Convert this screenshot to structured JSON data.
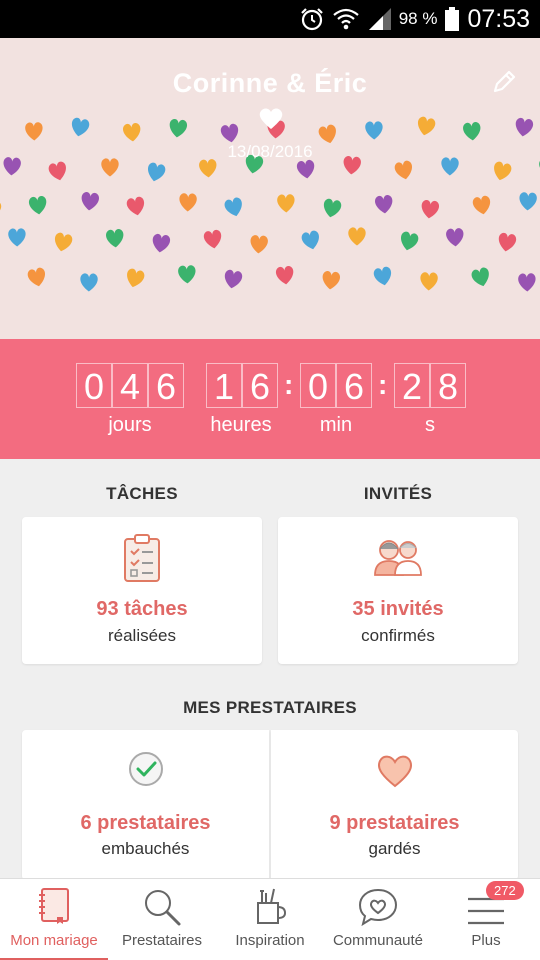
{
  "status_bar": {
    "battery_percent": "98 %",
    "clock": "07:53"
  },
  "hero": {
    "names": "Corinne & Éric",
    "date": "13/08/2016"
  },
  "countdown": {
    "days": [
      "0",
      "4",
      "6"
    ],
    "hours": [
      "1",
      "6"
    ],
    "minutes": [
      "0",
      "6"
    ],
    "seconds": [
      "2",
      "8"
    ],
    "labels": {
      "days": "jours",
      "hours": "heures",
      "minutes": "min",
      "seconds": "s"
    }
  },
  "tasks": {
    "title": "TÂCHES",
    "count": "93 tâches",
    "subtitle": "réalisées"
  },
  "guests": {
    "title": "INVITÉS",
    "count": "35 invités",
    "subtitle": "confirmés"
  },
  "vendors": {
    "title": "MES PRESTATAIRES",
    "hired": {
      "count": "6 prestataires",
      "subtitle": "embauchés"
    },
    "saved": {
      "count": "9 prestataires",
      "subtitle": "gardés"
    }
  },
  "tab_bar": {
    "items": [
      {
        "label": "Mon mariage",
        "icon": "notebook-icon",
        "active": true
      },
      {
        "label": "Prestataires",
        "icon": "search-icon"
      },
      {
        "label": "Inspiration",
        "icon": "pencil-cup-icon"
      },
      {
        "label": "Communauté",
        "icon": "chat-heart-icon"
      },
      {
        "label": "Plus",
        "icon": "hamburger-menu-icon",
        "badge": "272"
      }
    ]
  },
  "colors": {
    "countdown_bg": "#f36c80",
    "accent": "#e0605f",
    "hero_bg": "#f2e2e0"
  }
}
